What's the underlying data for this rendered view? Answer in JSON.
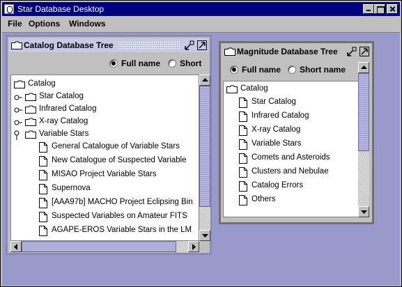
{
  "app": {
    "title": "Star Database Desktop"
  },
  "menubar": {
    "items": [
      "File",
      "Options",
      "Windows"
    ]
  },
  "catalog_window": {
    "title": "Catalog Database Tree",
    "radio_full": "Full name",
    "radio_short": "Short",
    "selected": "Full name",
    "root": "Catalog",
    "nodes": [
      "Star Catalog",
      "Infrared Catalog",
      "X-ray Catalog",
      "Variable Stars"
    ],
    "leaves": [
      "General Catalogue of Variable Stars",
      "New Catalogue of Suspected Variable",
      "MISAO Project Variable Stars",
      "Supernova",
      "[AAA97b] MACHO Project Eclipsing Bin",
      "Suspected Variables on Amateur FITS",
      "AGAPE-EROS Variable Stars in the LM"
    ]
  },
  "magnitude_window": {
    "title": "Magnitude Database Tree",
    "radio_full": "Full name",
    "radio_short": "Short name",
    "selected": "Full name",
    "root": "Catalog",
    "leaves": [
      "Star Catalog",
      "Infrared Catalog",
      "X-ray Catalog",
      "Variable Stars",
      "Comets and Asteroids",
      "Clusters and Nebulae",
      "Catalog Errors",
      "Others"
    ]
  }
}
